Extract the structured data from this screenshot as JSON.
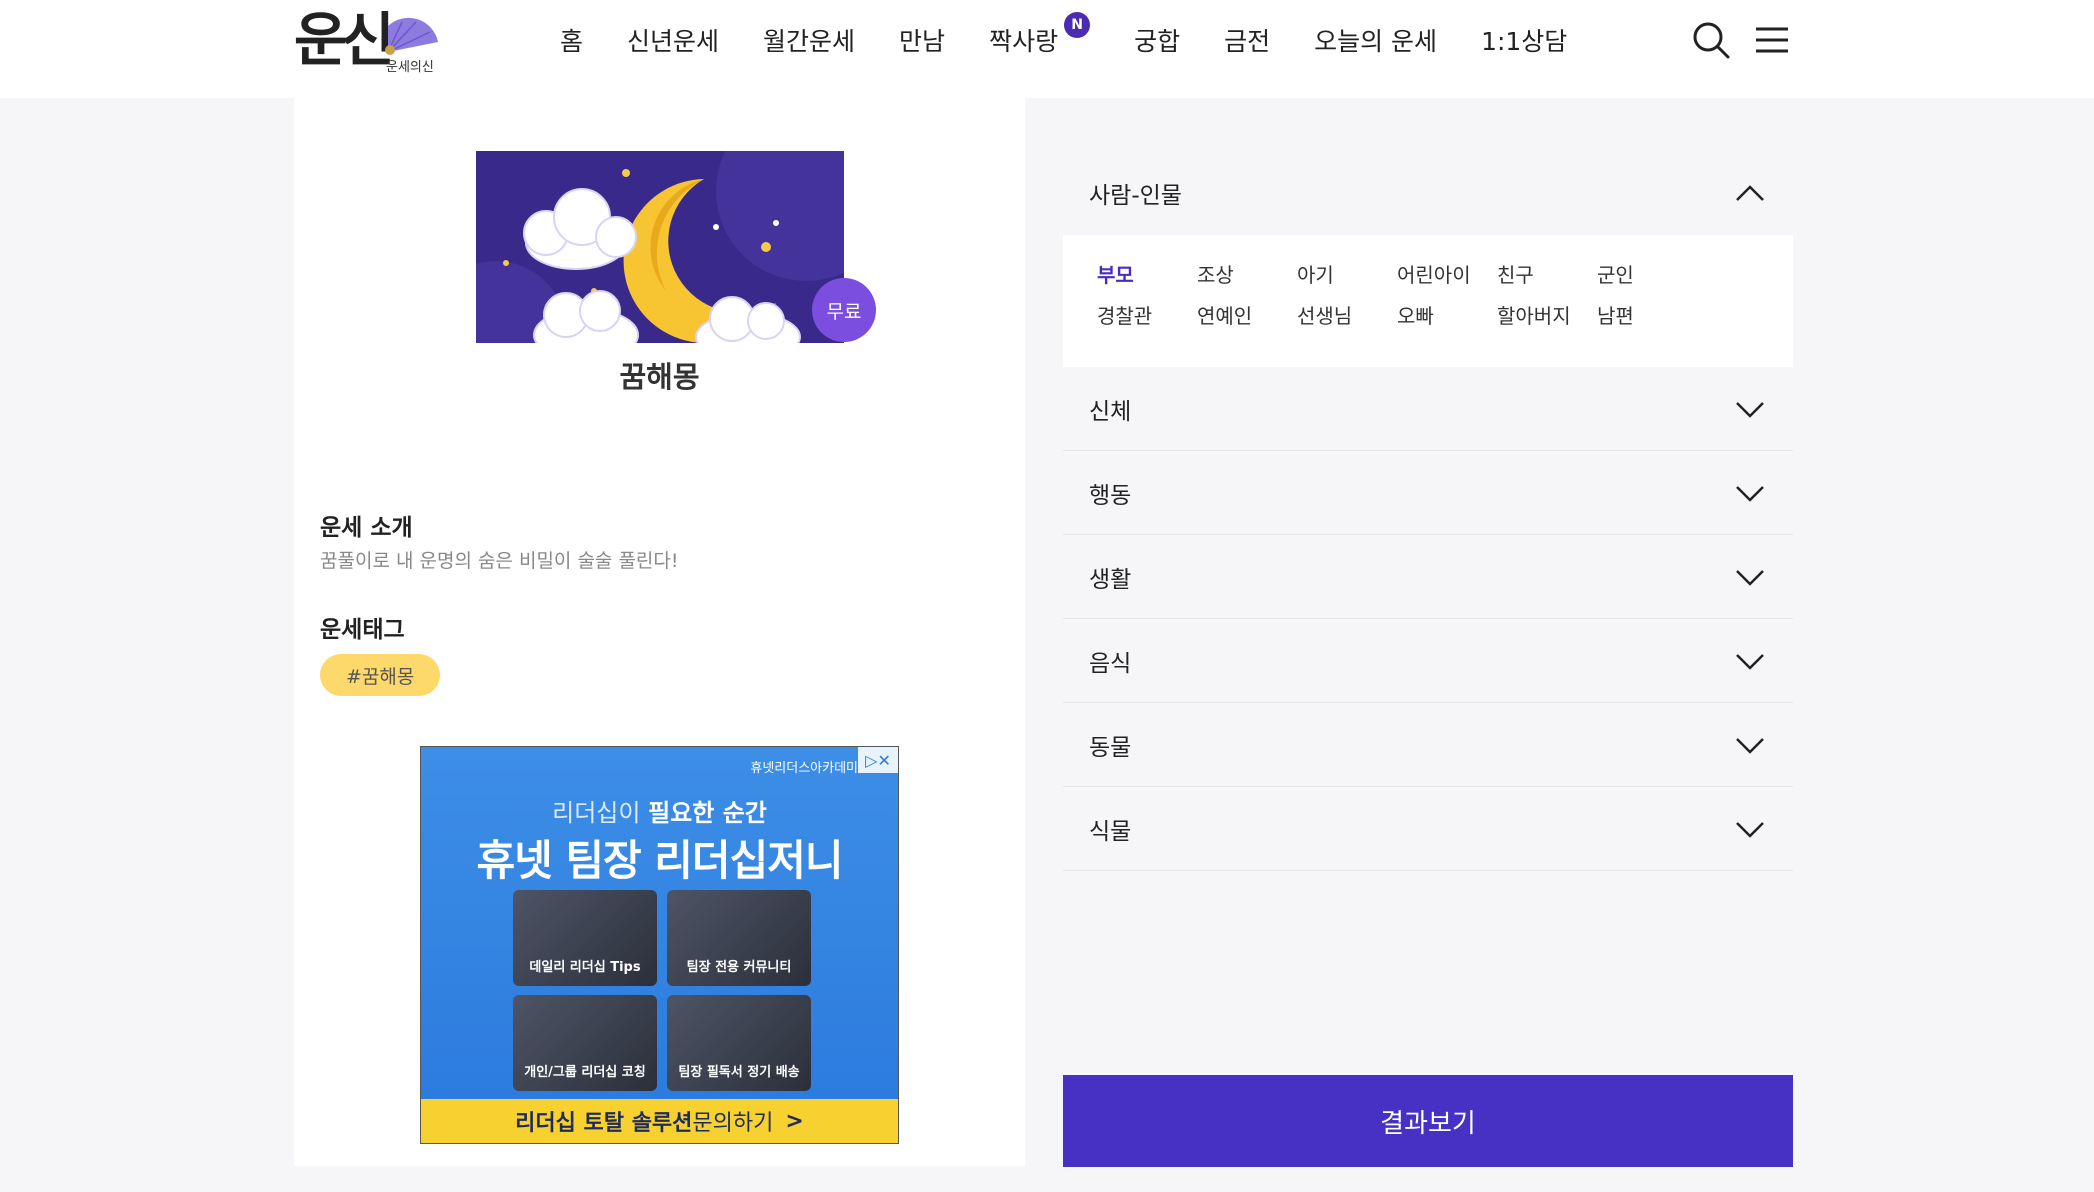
{
  "header": {
    "logo_text": "운신",
    "logo_sub": "운세의신",
    "nav": [
      {
        "label": "홈"
      },
      {
        "label": "신년운세"
      },
      {
        "label": "월간운세"
      },
      {
        "label": "만남"
      },
      {
        "label": "짝사랑",
        "badge": "N"
      },
      {
        "label": "궁합"
      },
      {
        "label": "금전"
      },
      {
        "label": "오늘의 운세"
      },
      {
        "label": "1:1상담"
      }
    ],
    "icons": [
      "search-icon",
      "menu-icon"
    ]
  },
  "product": {
    "badge": "무료",
    "title": "꿈해몽",
    "intro_title": "운세 소개",
    "intro_text": "꿈풀이로 내 운명의 숨은 비밀이 술술 풀린다!",
    "tag_title": "운세태그",
    "tags": [
      "#꿈해몽"
    ]
  },
  "ad": {
    "brand": "휴넷리더스아카데미",
    "headline_prefix": "리더십이 ",
    "headline_bold": "필요한 순간",
    "headline_main": "휴넷 팀장 리더십저니",
    "tiles": [
      "데일리 리더십 Tips",
      "팀장 전용 커뮤니티",
      "개인/그룹 리더십 코칭",
      "팀장 필독서 정기 배송"
    ],
    "cta_bold": "리더십 토탈 솔루션 ",
    "cta_light": "문의하기",
    "cta_arrow": ">"
  },
  "categories": {
    "sections": [
      {
        "label": "사람-인물",
        "open": true,
        "items": [
          "부모",
          "조상",
          "아기",
          "어린아이",
          "친구",
          "군인",
          "경찰관",
          "연예인",
          "선생님",
          "오빠",
          "할아버지",
          "남편"
        ],
        "selected": "부모"
      },
      {
        "label": "신체",
        "open": false
      },
      {
        "label": "행동",
        "open": false
      },
      {
        "label": "생활",
        "open": false
      },
      {
        "label": "음식",
        "open": false
      },
      {
        "label": "동물",
        "open": false
      },
      {
        "label": "식물",
        "open": false
      }
    ]
  },
  "result_button": "결과보기",
  "colors": {
    "accent": "#4631c4",
    "badge_purple": "#7b4ee0",
    "tag_yellow": "#fcd96a"
  }
}
